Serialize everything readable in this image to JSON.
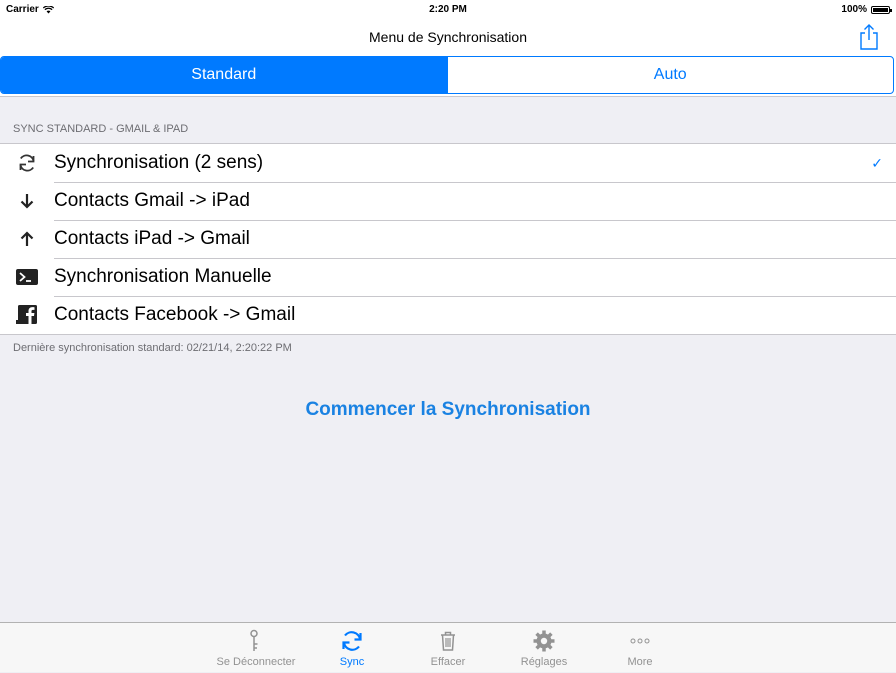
{
  "status_bar": {
    "carrier": "Carrier",
    "time": "2:20 PM",
    "battery": "100%"
  },
  "nav": {
    "title": "Menu de Synchronisation",
    "share_icon": "share-icon"
  },
  "segments": [
    {
      "label": "Standard",
      "selected": true
    },
    {
      "label": "Auto",
      "selected": false
    }
  ],
  "section": {
    "header": "SYNC STANDARD - GMAIL & IPAD",
    "rows": [
      {
        "icon": "sync-icon",
        "label": "Synchronisation (2 sens)",
        "checked": true
      },
      {
        "icon": "arrow-down-icon",
        "label": "Contacts Gmail -> iPad",
        "checked": false
      },
      {
        "icon": "arrow-up-icon",
        "label": "Contacts iPad -> Gmail",
        "checked": false
      },
      {
        "icon": "terminal-icon",
        "label": "Synchronisation Manuelle",
        "checked": false
      },
      {
        "icon": "facebook-icon",
        "label": "Contacts Facebook -> Gmail",
        "checked": false
      }
    ],
    "checkmark": "✓",
    "footer": "Dernière synchronisation standard: 02/21/14, 2:20:22 PM"
  },
  "start_button": "Commencer la Synchronisation",
  "tabs": [
    {
      "icon": "key-icon",
      "label": "Se Déconnecter",
      "active": false
    },
    {
      "icon": "sync-icon",
      "label": "Sync",
      "active": true
    },
    {
      "icon": "trash-icon",
      "label": "Effacer",
      "active": false
    },
    {
      "icon": "gear-icon",
      "label": "Réglages",
      "active": false
    },
    {
      "icon": "more-icon",
      "label": "More",
      "active": false
    }
  ],
  "colors": {
    "accent": "#007aff",
    "link": "#1a82e2",
    "background": "#efeff4",
    "tab_inactive": "#929292"
  }
}
